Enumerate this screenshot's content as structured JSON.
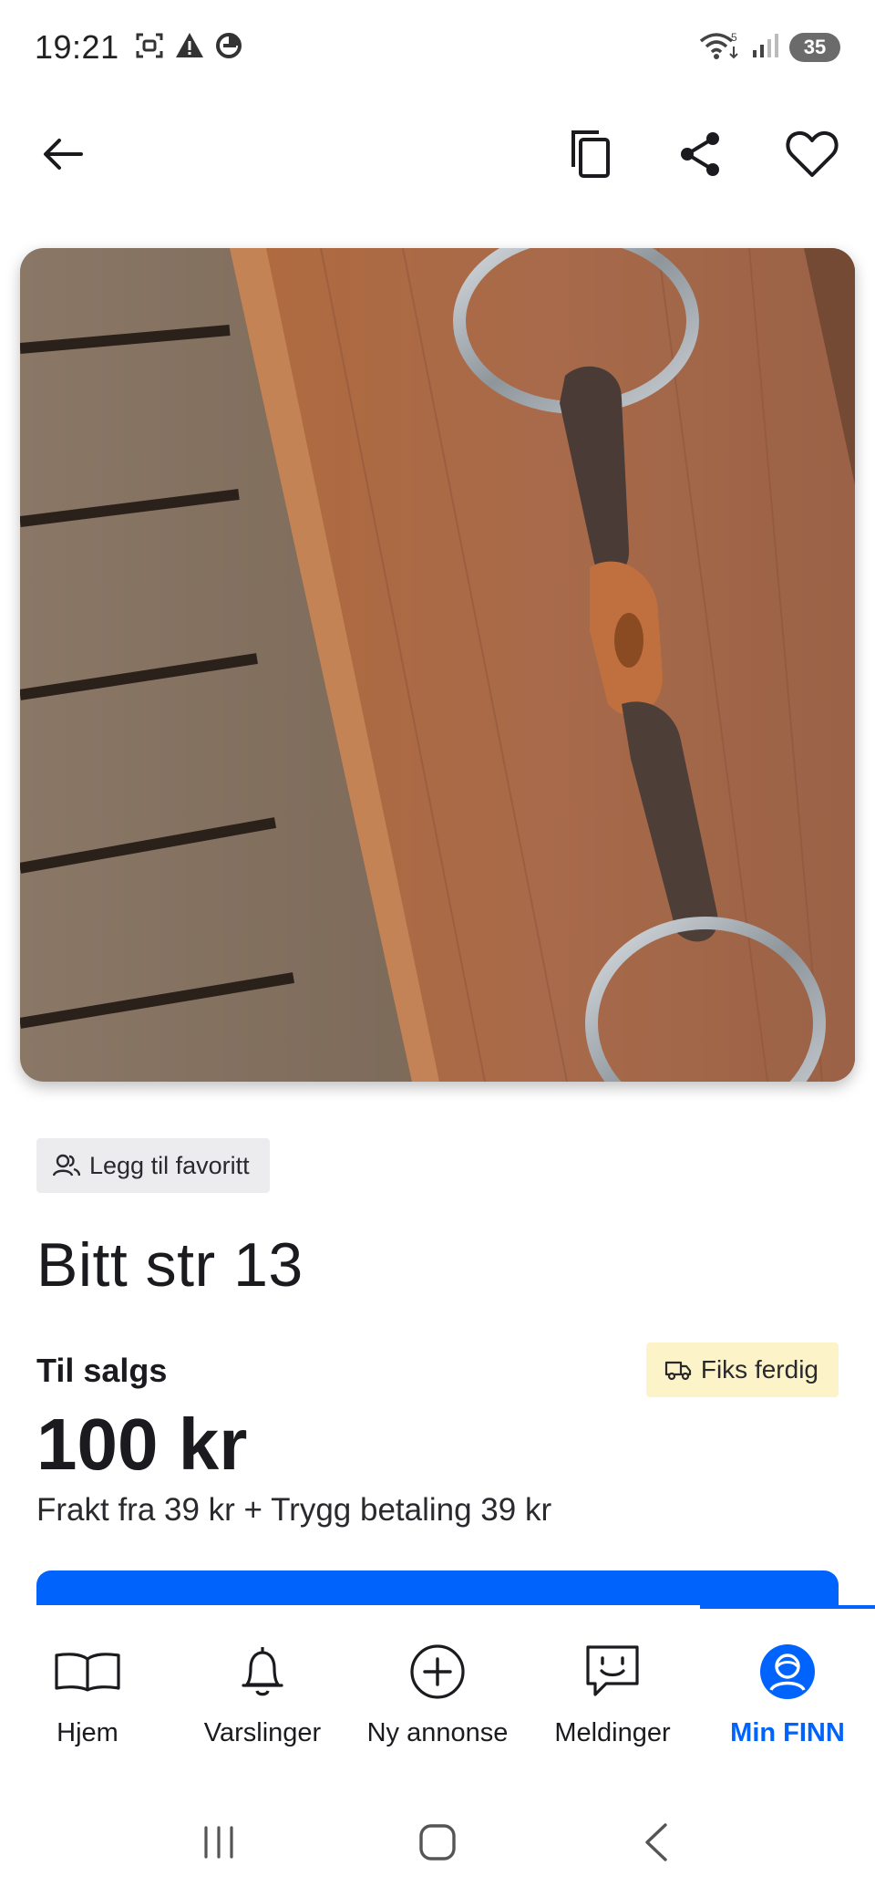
{
  "status_bar": {
    "time": "19:21",
    "left_icons": [
      "screenshot-icon",
      "alert-icon",
      "data-saver-icon"
    ],
    "right_icons": [
      "wifi-icon",
      "signal-icon"
    ],
    "battery": "35"
  },
  "app_bar": {
    "icons": [
      "back-arrow-icon",
      "copy-icon",
      "share-icon",
      "heart-icon"
    ]
  },
  "listing": {
    "favorite_chip": "Legg til favoritt",
    "title": "Bitt str 13",
    "sale_label": "Til salgs",
    "badge": "Fiks ferdig",
    "price": "100 kr",
    "shipping": "Frakt fra 39 kr + Trygg betaling 39 kr"
  },
  "bottom_nav": {
    "items": [
      {
        "label": "Hjem",
        "icon": "book-icon"
      },
      {
        "label": "Varslinger",
        "icon": "bell-icon"
      },
      {
        "label": "Ny annonse",
        "icon": "plus-circle-icon"
      },
      {
        "label": "Meldinger",
        "icon": "chat-smile-icon"
      },
      {
        "label": "Min FINN",
        "icon": "profile-icon"
      }
    ],
    "active_index": 4
  },
  "colors": {
    "accent": "#0063fb",
    "badge_bg": "#fdf3c8",
    "chip_bg": "#ececef"
  }
}
